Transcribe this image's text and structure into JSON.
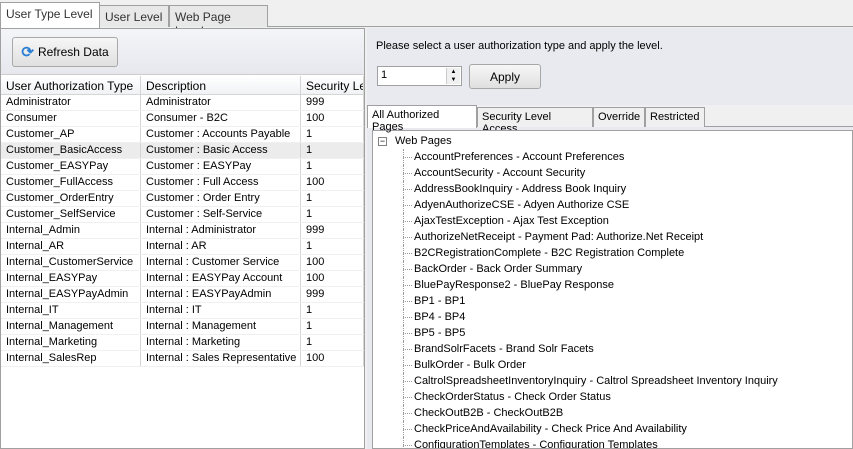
{
  "tabs": [
    "User Type Level",
    "User Level",
    "Web Page Level"
  ],
  "toolbar": {
    "refresh_label": "Refresh Data"
  },
  "grid": {
    "columns": [
      "User Authorization Type",
      "Description",
      "Security Level"
    ],
    "rows": [
      [
        "Administrator",
        "Administrator",
        "999"
      ],
      [
        "Consumer",
        "Consumer - B2C",
        "100"
      ],
      [
        "Customer_AP",
        "Customer : Accounts Payable",
        "1"
      ],
      [
        "Customer_BasicAccess",
        "Customer : Basic Access",
        "1"
      ],
      [
        "Customer_EASYPay",
        "Customer : EASYPay",
        "1"
      ],
      [
        "Customer_FullAccess",
        "Customer : Full Access",
        "100"
      ],
      [
        "Customer_OrderEntry",
        "Customer : Order Entry",
        "1"
      ],
      [
        "Customer_SelfService",
        "Customer : Self-Service",
        "1"
      ],
      [
        "Internal_Admin",
        "Internal : Administrator",
        "999"
      ],
      [
        "Internal_AR",
        "Internal : AR",
        "1"
      ],
      [
        "Internal_CustomerService",
        "Internal : Customer Service",
        "100"
      ],
      [
        "Internal_EASYPay",
        "Internal : EASYPay Account",
        "100"
      ],
      [
        "Internal_EASYPayAdmin",
        "Internal : EASYPayAdmin",
        "999"
      ],
      [
        "Internal_IT",
        "Internal : IT",
        "1"
      ],
      [
        "Internal_Management",
        "Internal : Management",
        "1"
      ],
      [
        "Internal_Marketing",
        "Internal : Marketing",
        "1"
      ],
      [
        "Internal_SalesRep",
        "Internal : Sales Representative",
        "100"
      ]
    ]
  },
  "right": {
    "prompt": "Please select a user authorization type and apply the level.",
    "level_value": "1",
    "apply_label": "Apply",
    "subtabs": [
      "All Authorized Pages",
      "Security Level Access",
      "Override",
      "Restricted"
    ],
    "tree_root": "Web Pages",
    "pages": [
      "AccountPreferences - Account Preferences",
      "AccountSecurity - Account Security",
      "AddressBookInquiry - Address Book Inquiry",
      "AdyenAuthorizeCSE - Adyen Authorize CSE",
      "AjaxTestException - Ajax Test Exception",
      "AuthorizeNetReceipt - Payment Pad: Authorize.Net Receipt",
      "B2CRegistrationComplete - B2C Registration Complete",
      "BackOrder - Back Order Summary",
      "BluePayResponse2 - BluePay Response",
      "BP1 - BP1",
      "BP4 - BP4",
      "BP5 - BP5",
      "BrandSolrFacets - Brand Solr Facets",
      "BulkOrder - Bulk Order",
      "CaltrolSpreadsheetInventoryInquiry - Caltrol Spreadsheet Inventory Inquiry",
      "CheckOrderStatus - Check Order Status",
      "CheckOutB2B - CheckOutB2B",
      "CheckPriceAndAvailability - Check Price And Availability",
      "ConfigurationTemplates - Configuration Templates"
    ]
  }
}
